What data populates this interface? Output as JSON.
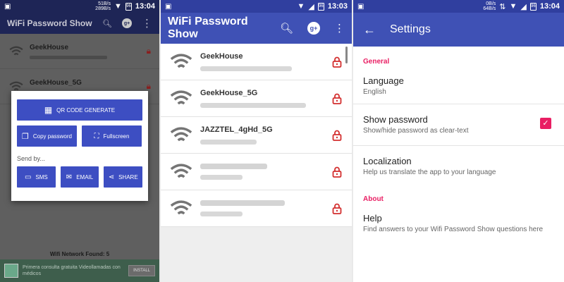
{
  "colors": {
    "primary": "#3f51b5",
    "primary_dark": "#303f9f",
    "accent": "#e91e63",
    "lock": "#d32f2f"
  },
  "screen1": {
    "status": {
      "speed": [
        "51B/s",
        "289B/s"
      ],
      "time": "13:04"
    },
    "title": "WiFi Password Show",
    "networks": [
      {
        "name": "GeekHouse"
      },
      {
        "name": "GeekHouse_5G"
      }
    ],
    "dialog": {
      "qr_label": "QR CODE GENERATE",
      "copy_label": "Copy password",
      "fullscreen_label": "Fullscreen",
      "send_by": "Send by...",
      "sms_label": "SMS",
      "email_label": "EMAIL",
      "share_label": "SHARE"
    },
    "found_text": "Wifi Network Found: 5",
    "ad": {
      "text": "Primera consulta gratuita Videollamadas con médicos",
      "install": "INSTALL"
    }
  },
  "screen2": {
    "status": {
      "time": "13:03"
    },
    "title": "WiFi Password Show",
    "networks": [
      {
        "name": "GeekHouse",
        "blurred": false
      },
      {
        "name": "GeekHouse_5G",
        "blurred": false
      },
      {
        "name": "JAZZTEL_4gHd_5G",
        "blurred": false
      },
      {
        "name": "",
        "blurred": true
      },
      {
        "name": "",
        "blurred": true
      }
    ]
  },
  "screen3": {
    "status": {
      "speed": [
        "0B/s",
        "64B/s"
      ],
      "time": "13:04"
    },
    "title": "Settings",
    "general_header": "General",
    "language": {
      "title": "Language",
      "summary": "English"
    },
    "show_password": {
      "title": "Show password",
      "summary": "Show/hide password as clear-text",
      "checked": true
    },
    "localization": {
      "title": "Localization",
      "summary": "Help us translate the app to your language"
    },
    "about_header": "About",
    "help": {
      "title": "Help",
      "summary": "Find answers to your Wifi Password Show questions here"
    }
  }
}
